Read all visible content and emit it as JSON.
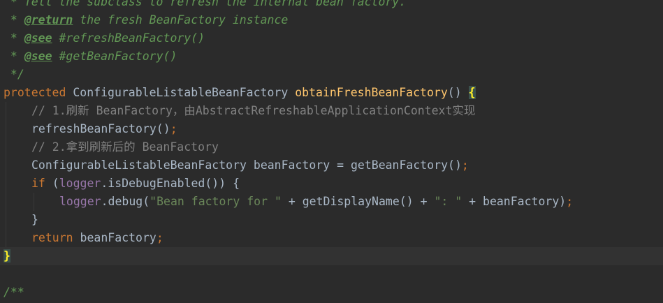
{
  "editor": {
    "lines": [
      {
        "tokens": [
          {
            "t": " * ",
            "c": "cm-doc"
          },
          {
            "t": "Tell the subclass to refresh the internal bean factory.",
            "c": "cm-doc"
          }
        ]
      },
      {
        "tokens": [
          {
            "t": " * ",
            "c": "cm-doc"
          },
          {
            "t": "@return",
            "c": "cm-doc-tag"
          },
          {
            "t": " the fresh BeanFactory instance",
            "c": "cm-doc"
          }
        ]
      },
      {
        "tokens": [
          {
            "t": " * ",
            "c": "cm-doc"
          },
          {
            "t": "@see",
            "c": "cm-doc-tag"
          },
          {
            "t": " #refreshBeanFactory()",
            "c": "cm-doc"
          }
        ]
      },
      {
        "tokens": [
          {
            "t": " * ",
            "c": "cm-doc"
          },
          {
            "t": "@see",
            "c": "cm-doc-tag"
          },
          {
            "t": " #getBeanFactory()",
            "c": "cm-doc"
          }
        ]
      },
      {
        "tokens": [
          {
            "t": " */",
            "c": "cm-doc"
          }
        ]
      },
      {
        "tokens": [
          {
            "t": "protected",
            "c": "cm-kw"
          },
          {
            "t": " ConfigurableListableBeanFactory ",
            "c": "cm-type"
          },
          {
            "t": "obtainFreshBeanFactory",
            "c": "cm-method"
          },
          {
            "t": "() ",
            "c": "cm-plain"
          },
          {
            "t": "{",
            "c": "brace-yellow"
          }
        ]
      },
      {
        "indent": 1,
        "tokens": [
          {
            "t": "// 1.刷新 BeanFactory，由AbstractRefreshableApplicationContext实现",
            "c": "cm-comment"
          }
        ]
      },
      {
        "indent": 1,
        "tokens": [
          {
            "t": "refreshBeanFactory()",
            "c": "cm-plain"
          },
          {
            "t": ";",
            "c": "cm-punct"
          }
        ]
      },
      {
        "indent": 1,
        "tokens": [
          {
            "t": "// 2.拿到刷新后的 BeanFactory",
            "c": "cm-comment"
          }
        ]
      },
      {
        "indent": 1,
        "tokens": [
          {
            "t": "ConfigurableListableBeanFactory beanFactory = getBeanFactory()",
            "c": "cm-plain"
          },
          {
            "t": ";",
            "c": "cm-punct"
          }
        ]
      },
      {
        "indent": 1,
        "tokens": [
          {
            "t": "if",
            "c": "cm-kw"
          },
          {
            "t": " (",
            "c": "cm-plain"
          },
          {
            "t": "logger",
            "c": "cm-field"
          },
          {
            "t": ".isDebugEnabled()) {",
            "c": "cm-plain"
          }
        ]
      },
      {
        "indent": 2,
        "tokens": [
          {
            "t": "logger",
            "c": "cm-field"
          },
          {
            "t": ".debug(",
            "c": "cm-plain"
          },
          {
            "t": "\"Bean factory for \"",
            "c": "cm-string"
          },
          {
            "t": " + getDisplayName() + ",
            "c": "cm-plain"
          },
          {
            "t": "\": \"",
            "c": "cm-string"
          },
          {
            "t": " + beanFactory)",
            "c": "cm-plain"
          },
          {
            "t": ";",
            "c": "cm-punct"
          }
        ]
      },
      {
        "indent": 1,
        "tokens": [
          {
            "t": "}",
            "c": "cm-plain"
          }
        ]
      },
      {
        "indent": 1,
        "tokens": [
          {
            "t": "return",
            "c": "cm-kw"
          },
          {
            "t": " beanFactory",
            "c": "cm-plain"
          },
          {
            "t": ";",
            "c": "cm-punct"
          }
        ]
      },
      {
        "current": true,
        "tokens": [
          {
            "t": "}",
            "c": "brace-yellow"
          }
        ]
      },
      {
        "tokens": []
      },
      {
        "tokens": [
          {
            "t": "/**",
            "c": "cm-doc"
          }
        ]
      }
    ]
  }
}
